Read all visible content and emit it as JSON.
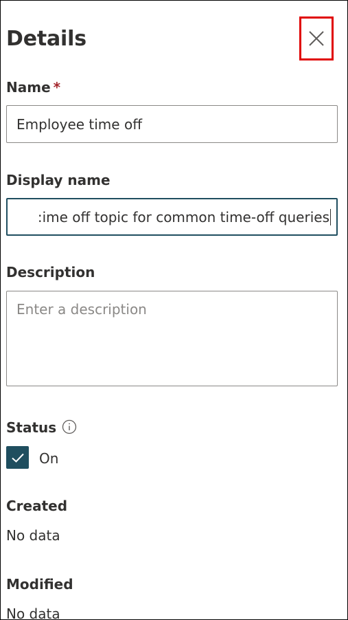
{
  "panel": {
    "title": "Details",
    "close_icon": "close-icon"
  },
  "name_field": {
    "label": "Name",
    "required_marker": "*",
    "value": "Employee time off"
  },
  "display_name_field": {
    "label": "Display name",
    "value": ":ime off topic for common time-off queries"
  },
  "description_field": {
    "label": "Description",
    "placeholder": "Enter a description"
  },
  "status": {
    "label": "Status",
    "info_icon": "info-icon",
    "checked": true,
    "checkbox_label": "On"
  },
  "created": {
    "label": "Created",
    "value": "No data"
  },
  "modified": {
    "label": "Modified",
    "value": "No data"
  },
  "colors": {
    "accent": "#1f4e5f",
    "highlight_border": "#e00000",
    "required": "#a4262c"
  }
}
